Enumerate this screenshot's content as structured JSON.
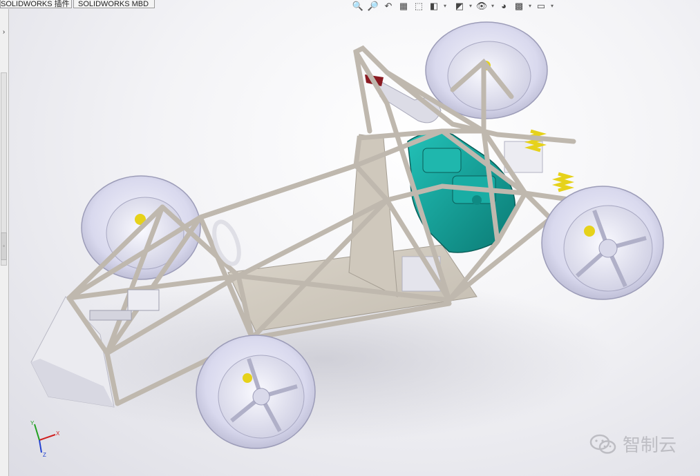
{
  "tabs": [
    {
      "label": "SOLIDWORKS 插件"
    },
    {
      "label": "SOLIDWORKS MBD"
    }
  ],
  "sidebar": {
    "collapse_glyph": "›",
    "pin_glyph": "◦"
  },
  "view_toolbar": {
    "items": [
      {
        "name": "zoom-to-fit-icon",
        "glyph": "🔍"
      },
      {
        "name": "zoom-to-area-icon",
        "glyph": "🔎"
      },
      {
        "name": "previous-view-icon",
        "glyph": "↶"
      },
      {
        "name": "section-view-icon",
        "glyph": "▦"
      },
      {
        "name": "view-selector-icon",
        "glyph": "⬚"
      },
      {
        "name": "view-orientation-icon",
        "glyph": "◧"
      },
      {
        "name": "display-style-icon",
        "glyph": "◩"
      },
      {
        "name": "hide-show-items-icon",
        "glyph": "👁"
      },
      {
        "name": "edit-appearance-icon",
        "glyph": "◕"
      },
      {
        "name": "apply-scene-icon",
        "glyph": "▩"
      },
      {
        "name": "view-settings-icon",
        "glyph": "▭"
      }
    ],
    "dropdown_glyph": "▾"
  },
  "triad": {
    "x_label": "X",
    "y_label": "Y",
    "z_label": "Z"
  },
  "watermark": {
    "text": "智制云"
  },
  "colors": {
    "frame": "#bfb8ae",
    "tire": "#dcdcf0",
    "engine": "#14a39b",
    "shock": "#e6d21a",
    "hubcap": "#ececf7"
  }
}
